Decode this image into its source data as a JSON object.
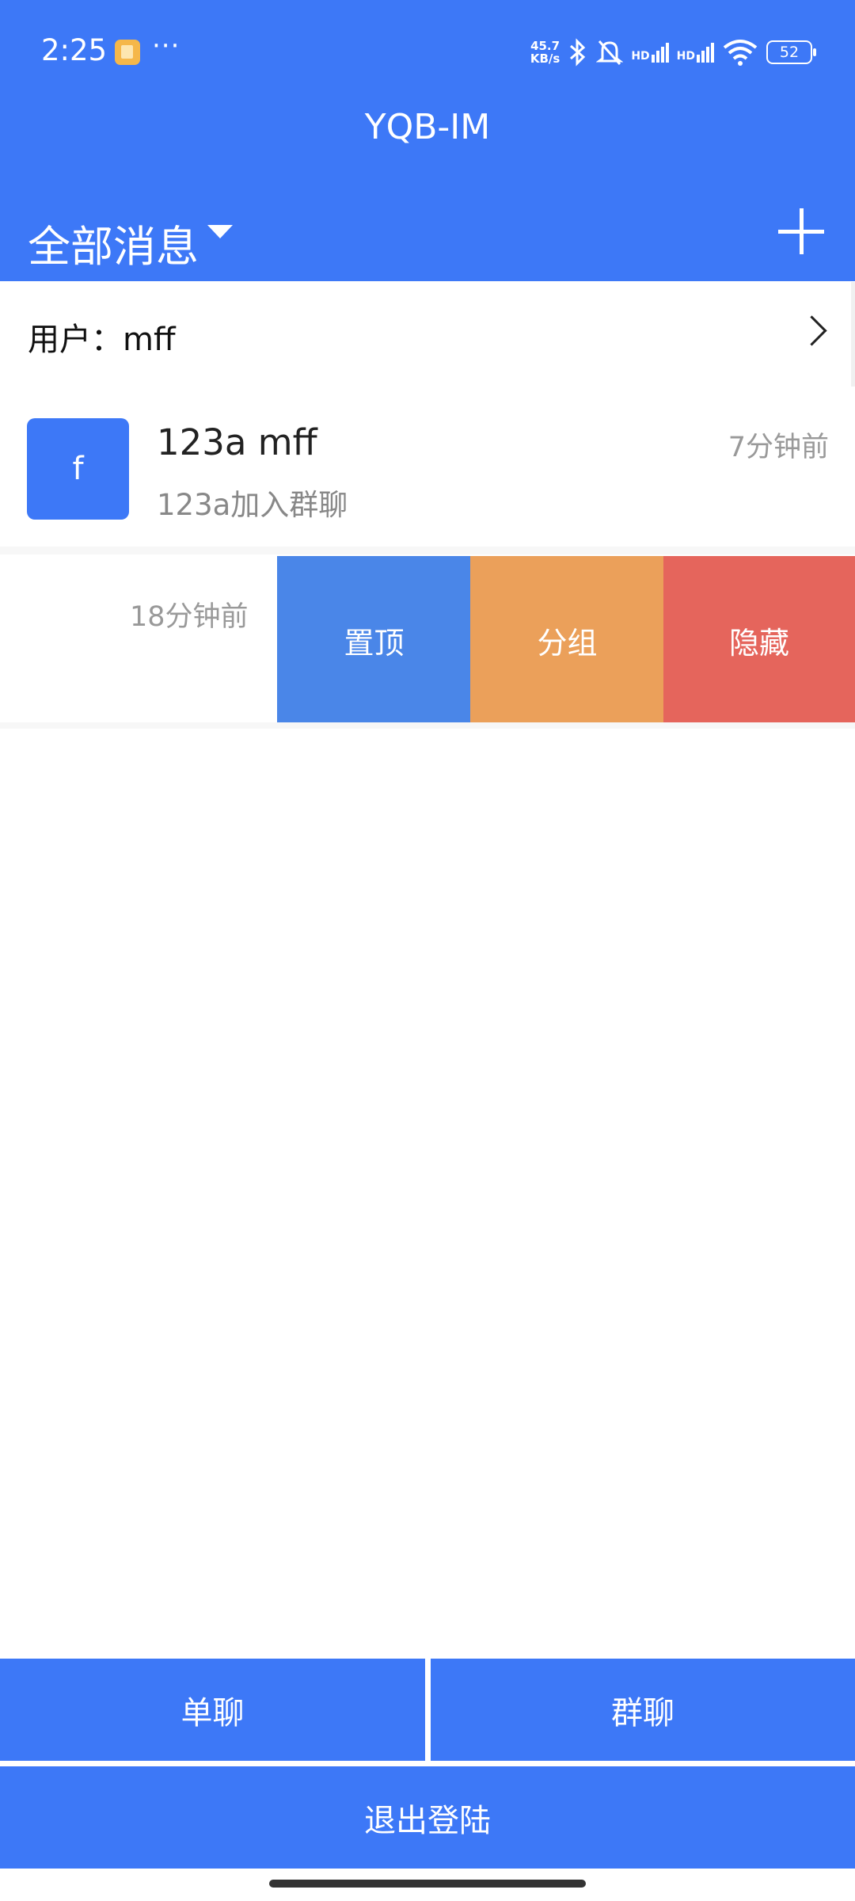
{
  "status_bar": {
    "time": "2:25",
    "more": "···",
    "net_speed_value": "45.7",
    "net_speed_unit": "KB/s",
    "signal_label": "HD",
    "wifi_sub": "6",
    "battery": "52"
  },
  "header": {
    "title": "YQB-IM",
    "filter_label": "全部消息"
  },
  "user_row": {
    "label": "用户：mff"
  },
  "conversations": [
    {
      "avatar_letter": "f",
      "title": "123a mff",
      "preview": "123a加入群聊",
      "time": "7分钟前"
    },
    {
      "time": "18分钟前",
      "actions": {
        "pin": "置顶",
        "group": "分组",
        "hide": "隐藏"
      }
    }
  ],
  "bottom": {
    "single_chat": "单聊",
    "group_chat": "群聊",
    "logout": "退出登陆"
  },
  "colors": {
    "primary": "#3d78f7",
    "pin": "#4a86e8",
    "group": "#eba05a",
    "hide": "#e5655c"
  }
}
